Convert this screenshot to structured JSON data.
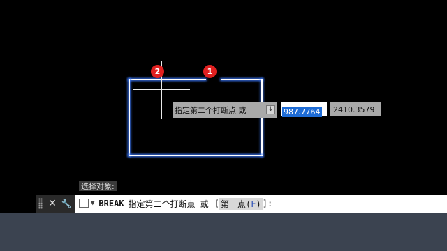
{
  "canvas": {
    "markers": [
      "2",
      "1"
    ],
    "dynamic_input": {
      "prompt": "指定第二个打断点 或",
      "arrow_glyph": "↓",
      "x_value": "987.7764",
      "y_value": "2410.3579"
    }
  },
  "command_history": "选择对象:",
  "command_line": {
    "command": "BREAK",
    "prompt_text": "指定第二个打断点 或",
    "bracket_open": "[",
    "option_label": "第一点",
    "option_key_open": "(",
    "option_key": "F",
    "option_key_close": ")",
    "bracket_close": "]:",
    "close_glyph": "✕",
    "customize_glyph": "🔧"
  },
  "colors": {
    "selection_glow": "#3d7bff",
    "marker": "#e02020",
    "highlight": "#1e6cd6"
  }
}
